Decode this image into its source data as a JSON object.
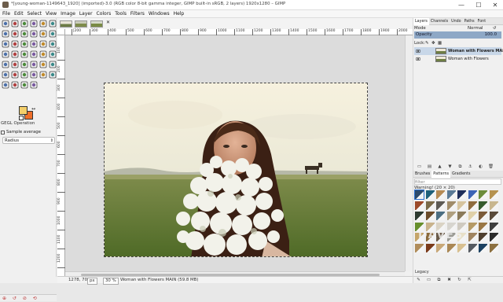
{
  "window": {
    "title": "*[young-woman-1149643_1920] (imported)-3.0 (RGB color 8-bit gamma integer, GIMP built-in sRGB, 2 layers) 1920x1280 – GIMP",
    "controls": [
      "—",
      "☐",
      "✕"
    ]
  },
  "menubar": [
    "File",
    "Edit",
    "Select",
    "View",
    "Image",
    "Layer",
    "Colors",
    "Tools",
    "Filters",
    "Windows",
    "Help"
  ],
  "toolbox": {
    "tools": [
      "rect-select-icon",
      "ellipse-select-icon",
      "lasso-icon",
      "fuzzy-select-icon",
      "select-by-color-icon",
      "scissors-icon",
      "foreground-select-icon",
      "paths-icon",
      "color-picker-icon",
      "zoom-icon",
      "measure-icon",
      "move-icon",
      "align-icon",
      "crop-icon",
      "unified-transform-icon",
      "rotate-icon",
      "scale-icon",
      "shear-icon",
      "perspective-icon",
      "3d-transform-icon",
      "flip-icon",
      "cage-icon",
      "warp-icon",
      "handle-transform-icon",
      "text-icon",
      "bucket-fill-icon",
      "blend-icon",
      "pencil-icon",
      "paintbrush-icon",
      "eraser-icon",
      "airbrush-icon",
      "ink-icon",
      "mypaint-icon",
      "clone-icon",
      "perspective-clone-icon",
      "heal-icon",
      "blur-icon",
      "smudge-icon",
      "dodge-icon",
      "gegl-icon"
    ],
    "colors": {
      "fg": "#f4cf6a",
      "bg": "#ee6e2a"
    },
    "options": {
      "header": "GEGL Operation",
      "sample_average": "Sample average",
      "radius_label": "Radius"
    }
  },
  "image_tabs": {
    "close": "✕"
  },
  "ruler": {
    "h": [
      "|200",
      "300",
      "400",
      "500",
      "600",
      "700",
      "800",
      "900",
      "1000",
      "1100",
      "1200",
      "1300",
      "1400",
      "1500",
      "1600",
      "1700",
      "1800",
      "1900",
      "2000"
    ],
    "v": [
      "100",
      "200",
      "300",
      "400",
      "500",
      "600",
      "700",
      "800",
      "900",
      "1000",
      "1100",
      "1200"
    ]
  },
  "statusbar": {
    "coords": "1278, 700",
    "unit": "px",
    "zoom": "30 %",
    "layer": "Woman with Flowers MAIN (59.8 MB)"
  },
  "layers_panel": {
    "tabs": [
      "Layers",
      "Channels",
      "Undo",
      "Paths",
      "Font"
    ],
    "mode_label": "Mode",
    "mode_value": "Normal",
    "opacity_label": "Opacity",
    "opacity_value": "100.0",
    "lock_label": "Lock:",
    "layers": [
      {
        "name": "Woman with Flowers MAIN",
        "active": true
      },
      {
        "name": "Woman with Flowers",
        "active": false
      }
    ]
  },
  "patterns_panel": {
    "tabs": [
      "Brushes",
      "Patterns",
      "Gradients"
    ],
    "filter": "filter",
    "current": "Warning! (20 × 20)",
    "colors": [
      "#2c4a6b",
      "#1e5f7a",
      "#b68b54",
      "#5a7a96",
      "#1f2e5a",
      "#3c63b5",
      "#6c8c3a",
      "#b5924f",
      "#9c4a2a",
      "#7a6a48",
      "#5d5a55",
      "#a08c6a",
      "#d6c49e",
      "#8e6b3d",
      "#365b2d",
      "#c8b68e",
      "#2d3a30",
      "#6b4b2a",
      "#4c6e82",
      "#b0a080",
      "#8a7a5a",
      "#e0d0a8",
      "#7c5b39",
      "#5a4a3a",
      "#678f2c",
      "#c9b38c",
      "#dad3c4",
      "#d7d5cf",
      "#cfcac0",
      "#b59a66",
      "#9a7744",
      "#3e3e3e",
      "#c5a56a",
      "#8b6a3a",
      "#6a5a48",
      "#9b9b95",
      "#e8e0c8",
      "#a08460",
      "#4f3f2f",
      "#2b2b2b",
      "#b08c5a",
      "#7a3a1a",
      "#c8a878",
      "#aa8855",
      "#d8c090",
      "#555a60",
      "#1a4060",
      "#8c7040"
    ],
    "watermark": "DAVES",
    "status": "Legacy"
  }
}
